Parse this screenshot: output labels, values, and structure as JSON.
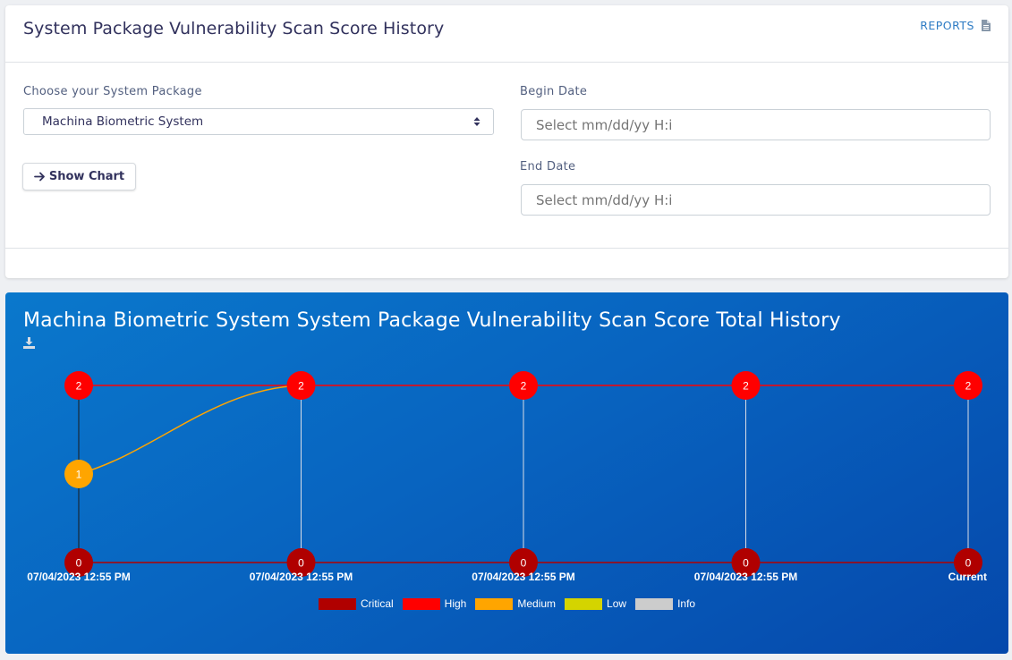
{
  "header": {
    "title": "System Package Vulnerability Scan Score History",
    "reports_label": "REPORTS",
    "reports_icon": "document-icon"
  },
  "form": {
    "package_label": "Choose your System Package",
    "package_value": "Machina Biometric System",
    "show_chart_label": "Show Chart",
    "begin_label": "Begin Date",
    "begin_placeholder": "Select mm/dd/yy H:i",
    "end_label": "End Date",
    "end_placeholder": "Select mm/dd/yy H:i"
  },
  "chart_card": {
    "title": "Machina Biometric System System Package Vulnerability Scan Score Total History",
    "download_icon": "download-icon"
  },
  "colors": {
    "critical": "#b00000",
    "high": "#ff0000",
    "medium": "#ffa500",
    "low": "#d4d400",
    "info": "#cccccc"
  },
  "chart_data": {
    "type": "line",
    "categories": [
      "07/04/2023 12:55 PM",
      "07/04/2023 12:55 PM",
      "07/04/2023 12:55 PM",
      "07/04/2023 12:55 PM",
      "Current"
    ],
    "series": [
      {
        "name": "Critical",
        "values": [
          0,
          0,
          0,
          0,
          0
        ]
      },
      {
        "name": "High",
        "values": [
          2,
          2,
          2,
          2,
          2
        ]
      },
      {
        "name": "Medium",
        "values": [
          1,
          2,
          null,
          null,
          null
        ]
      },
      {
        "name": "Low",
        "values": [
          null,
          null,
          null,
          null,
          null
        ]
      },
      {
        "name": "Info",
        "values": [
          null,
          null,
          null,
          null,
          null
        ]
      }
    ],
    "ylim": [
      0,
      2
    ],
    "grid": true,
    "legend": "bottom"
  }
}
